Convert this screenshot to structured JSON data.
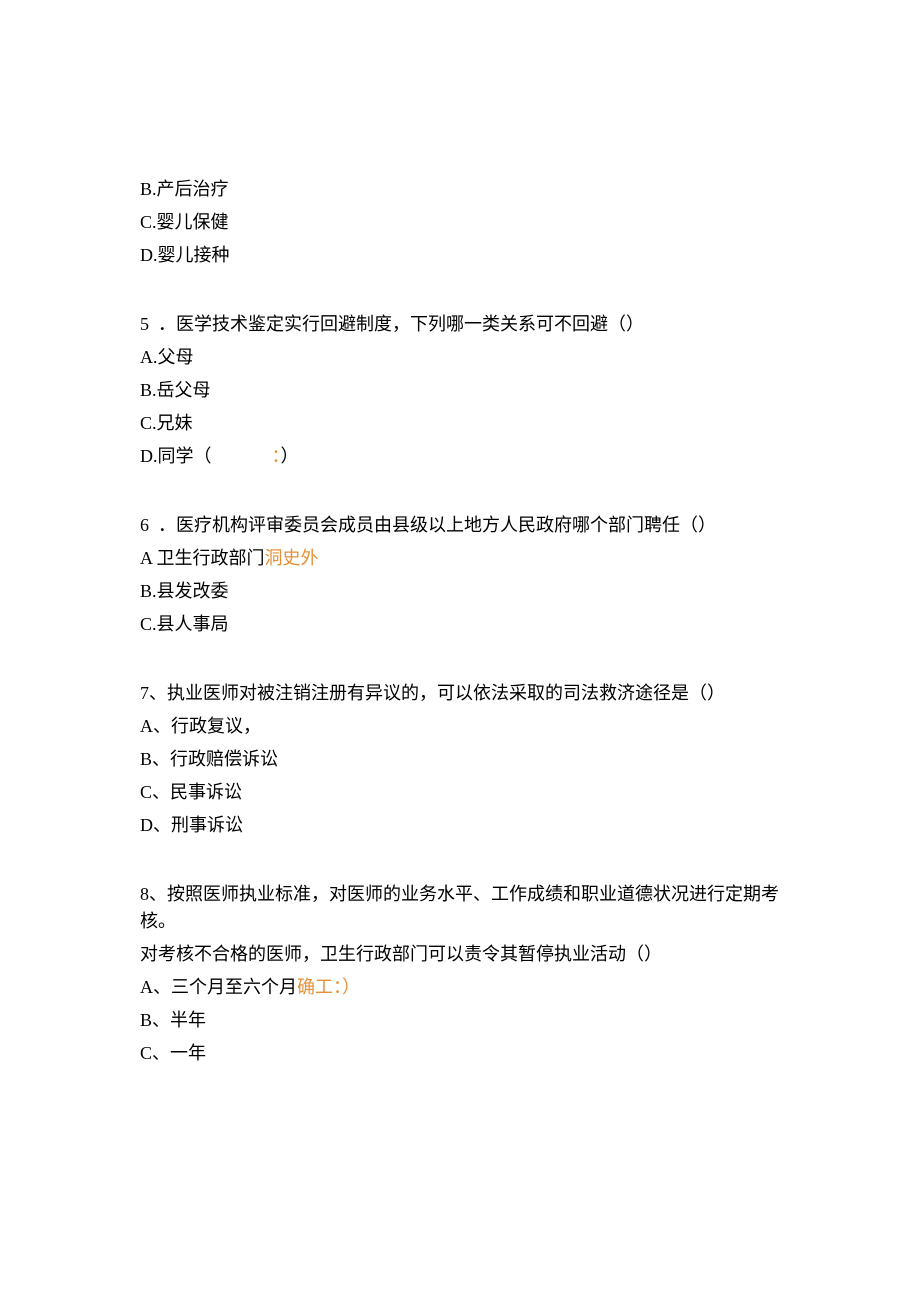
{
  "q4_partial": {
    "opts": [
      {
        "label": "B.产后治疗"
      },
      {
        "label": "C.婴儿保健"
      },
      {
        "label": "D.婴儿接种"
      }
    ]
  },
  "q5": {
    "num": "5",
    "sep": "．",
    "text": "医学技术鉴定实行回避制度，下列哪一类关系可不回避（）",
    "opts": [
      {
        "label": "A.父母"
      },
      {
        "label": "B.岳父母"
      },
      {
        "label": "C.兄妹"
      },
      {
        "label_prefix": "D.同学（",
        "orange": "：",
        "label_suffix": "）"
      }
    ]
  },
  "q6": {
    "num": "6",
    "sep": "．",
    "text": "医疗机构评审委员会成员由县级以上地方人民政府哪个部门聘任（）",
    "opts": [
      {
        "label_prefix": "A 卫生行政部门",
        "orange": "洞史外"
      },
      {
        "label": "B.县发改委"
      },
      {
        "label": "C.县人事局"
      }
    ]
  },
  "q7": {
    "num": "7、",
    "text": "执业医师对被注销注册有异议的，可以依法采取的司法救济途径是（）",
    "opts": [
      {
        "label": "A、行政复议，"
      },
      {
        "label": "B、行政赔偿诉讼"
      },
      {
        "label": "C、民事诉讼"
      },
      {
        "label": "D、刑事诉讼"
      }
    ]
  },
  "q8": {
    "num": "8、",
    "text_line1": "按照医师执业标准，对医师的业务水平、工作成绩和职业道德状况进行定期考核。",
    "text_line2": "对考核不合格的医师，卫生行政部门可以责令其暂停执业活动（）",
    "opts": [
      {
        "label_prefix": "A、三个月至六个月",
        "orange": "确工：）"
      },
      {
        "label": "B、半年"
      },
      {
        "label": "C、一年"
      }
    ]
  }
}
